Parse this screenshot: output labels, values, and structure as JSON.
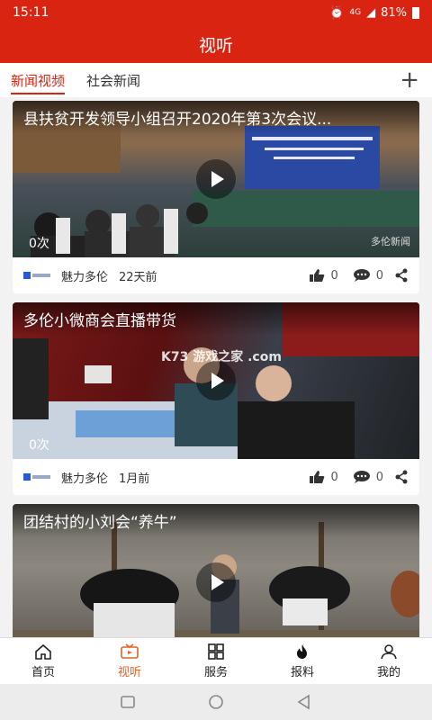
{
  "status": {
    "time": "15:11",
    "network": "4G",
    "battery": "81%"
  },
  "header": {
    "title": "视听"
  },
  "tabs": [
    {
      "label": "新闻视频",
      "active": true
    },
    {
      "label": "社会新闻",
      "active": false
    }
  ],
  "cards": [
    {
      "title": "县扶贫开发领导小组召开2020年第3次会议...",
      "views": "0次",
      "source": "魅力多伦",
      "time": "22天前",
      "likes": "0",
      "comments": "0",
      "watermark": "多伦新闻"
    },
    {
      "title": "多伦小微商会直播带货",
      "views": "0次",
      "source": "魅力多伦",
      "time": "1月前",
      "likes": "0",
      "comments": "0",
      "watermark": "K73 游戏之家 .com"
    },
    {
      "title": "团结村的小刘会“养牛”"
    }
  ],
  "bottom_tabs": [
    {
      "label": "首页",
      "icon": "home-icon",
      "active": false
    },
    {
      "label": "视听",
      "icon": "tv-icon",
      "active": true
    },
    {
      "label": "服务",
      "icon": "grid-icon",
      "active": false
    },
    {
      "label": "报料",
      "icon": "flame-icon",
      "active": false
    },
    {
      "label": "我的",
      "icon": "user-icon",
      "active": false
    }
  ],
  "colors": {
    "brand": "#d92412",
    "active_tab": "#e0622b"
  }
}
